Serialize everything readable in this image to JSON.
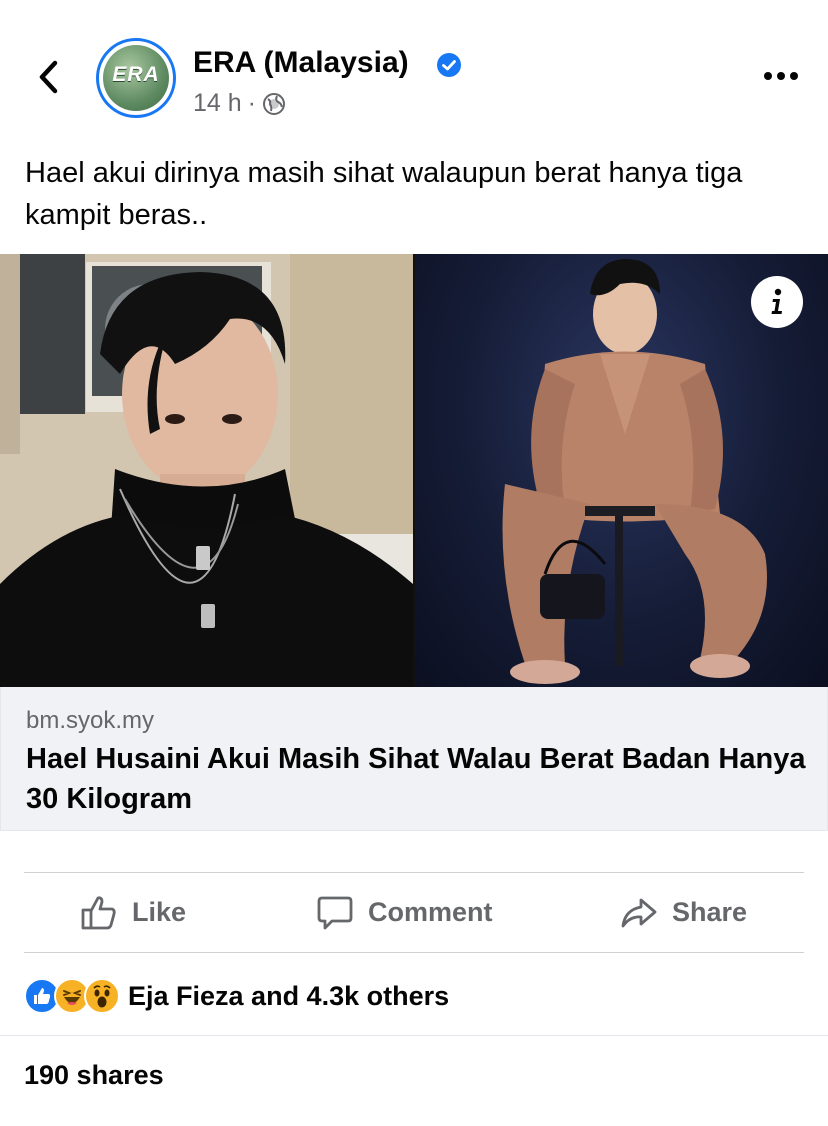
{
  "header": {
    "page_name": "ERA (Malaysia)",
    "avatar_logo": "ERA",
    "time": "14 h",
    "separator": "·",
    "icons": {
      "back": "chevron-left-icon",
      "verified": "verified-badge-icon",
      "audience": "globe-icon",
      "more": "more-horizontal-icon"
    },
    "accent_color": "#1877f2"
  },
  "post": {
    "text": "Hael akui dirinya masih sihat walaupun berat hanya tiga kampit beras.."
  },
  "link_preview": {
    "domain": "bm.syok.my",
    "title": "Hael Husaini Akui Masih Sihat Walau Berat Badan Hanya 30 Kilogram",
    "info_icon": "info-icon"
  },
  "actions": {
    "like": "Like",
    "comment": "Comment",
    "share": "Share"
  },
  "reactions": {
    "icons": [
      "like-reaction-icon",
      "haha-reaction-icon",
      "wow-reaction-icon"
    ],
    "text": "Eja Fieza and 4.3k others"
  },
  "shares": "190 shares"
}
